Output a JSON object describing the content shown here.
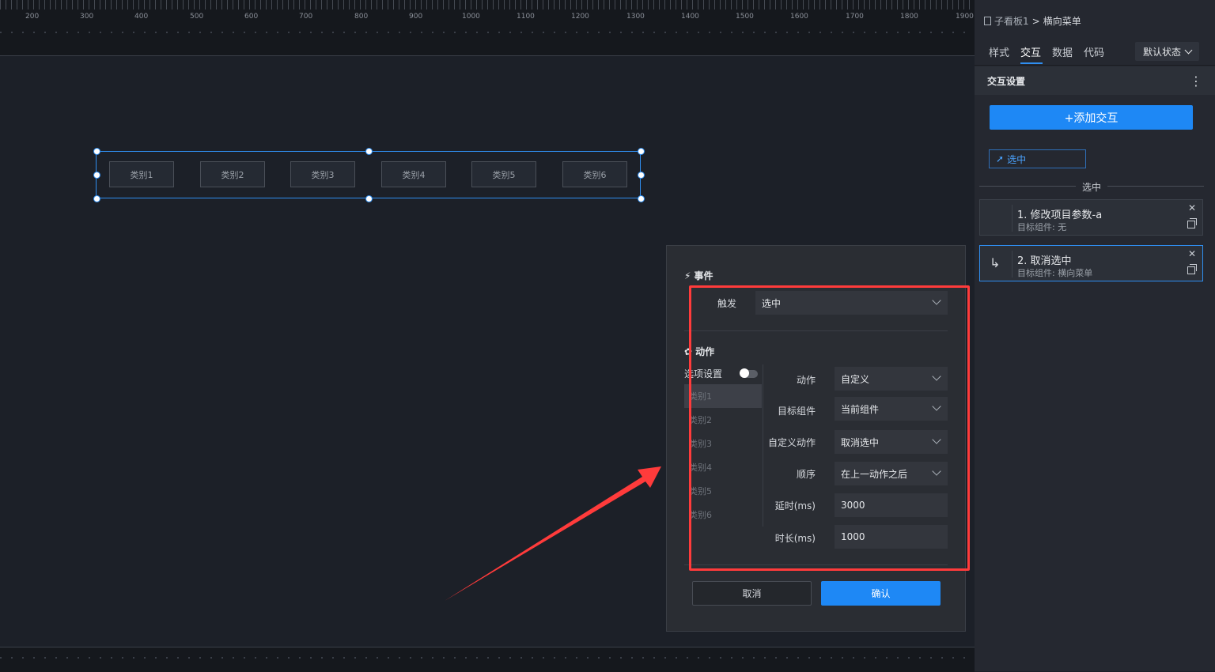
{
  "ruler": {
    "marks": [
      "200",
      "300",
      "400",
      "500",
      "600",
      "700",
      "800",
      "900",
      "1000",
      "1100",
      "1200",
      "1300",
      "1400",
      "1500",
      "1600",
      "1700",
      "1800",
      "1900"
    ]
  },
  "menu_widget": {
    "items": [
      "类别1",
      "类别2",
      "类别3",
      "类别4",
      "类别5",
      "类别6"
    ]
  },
  "panel": {
    "breadcrumb": {
      "board": "子看板1",
      "separator": ">",
      "current": "横向菜单"
    },
    "tabs": [
      "样式",
      "交互",
      "数据",
      "代码"
    ],
    "active_tab": "交互",
    "state_select": "默认状态",
    "section_title": "交互设置",
    "add_button": "+添加交互",
    "trigger_chip": "选中",
    "group_title": "选中",
    "actions": [
      {
        "title": "1. 修改项目参数-a",
        "target": "目标组件: 无"
      },
      {
        "title": "2. 取消选中",
        "target": "目标组件: 横向菜单"
      }
    ]
  },
  "dialog": {
    "event_label": "事件",
    "trigger_label": "触发",
    "trigger_value": "选中",
    "action_label": "动作",
    "option_setting": "选项设置",
    "options": [
      "类别1",
      "类别2",
      "类别3",
      "类别4",
      "类别5",
      "类别6"
    ],
    "fields": {
      "action": {
        "label": "动作",
        "value": "自定义"
      },
      "target": {
        "label": "目标组件",
        "value": "当前组件"
      },
      "custom_action": {
        "label": "自定义动作",
        "value": "取消选中"
      },
      "order": {
        "label": "顺序",
        "value": "在上一动作之后"
      },
      "delay": {
        "label": "延时(ms)",
        "value": "3000"
      },
      "duration": {
        "label": "时长(ms)",
        "value": "1000"
      }
    },
    "cancel": "取消",
    "confirm": "确认"
  },
  "colors": {
    "accent": "#1e88f5",
    "annotation": "#ff3b3b",
    "selection": "#2f8ef0"
  }
}
